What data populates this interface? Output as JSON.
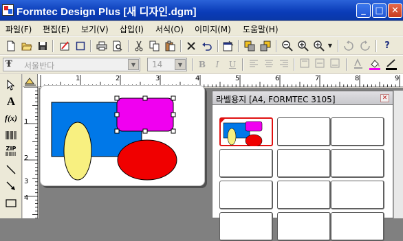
{
  "window": {
    "title": "Formtec Design Plus [새 디자인.dgm]",
    "caption_buttons": [
      "_",
      "□",
      "✕"
    ]
  },
  "menu": [
    {
      "label": "파일(F)"
    },
    {
      "label": "편집(E)"
    },
    {
      "label": "보기(V)"
    },
    {
      "label": "삽입(I)"
    },
    {
      "label": "서식(O)"
    },
    {
      "label": "이미지(M)"
    },
    {
      "label": "도움말(H)"
    }
  ],
  "toolbar1": {
    "icons": [
      "new-icon",
      "open-icon",
      "save-icon",
      "edit-label-icon",
      "select-rect-icon",
      "print-icon",
      "print-preview-icon",
      "cut-icon",
      "copy-icon",
      "paste-icon",
      "delete-icon",
      "undo-icon",
      "properties-icon",
      "group-icon",
      "ungroup-icon",
      "zoom-out-icon",
      "zoom-in-icon",
      "zoom-icon",
      "rotate-left-icon",
      "rotate-right-icon",
      "help-icon"
    ]
  },
  "format_toolbar": {
    "font_name": "서울반다",
    "font_size": "14",
    "bold": "B",
    "italic": "I",
    "underline": "U"
  },
  "tools": [
    "pointer-icon",
    "text-icon",
    "formula-icon",
    "barcode-icon",
    "zip-icon",
    "line-icon",
    "arrow-icon",
    "rectangle-icon"
  ],
  "tool_labels": {
    "text": "A",
    "formula": "f(x)",
    "zip": "ZIP"
  },
  "rulers": {
    "horizontal": [
      "1",
      "2",
      "3",
      "4",
      "5",
      "6",
      "7",
      "8",
      "9"
    ],
    "vertical": [
      "1",
      "2",
      "3",
      "4"
    ]
  },
  "label_window": {
    "title": "라벨용지 [A4, FORMTEC 3105]",
    "close_label": "✕"
  },
  "colors": {
    "title_bar": "#0a3cb8",
    "shape_blue": "#0078e8",
    "shape_magenta": "#f000f0",
    "shape_yellow": "#f8f080",
    "shape_red": "#f00000",
    "active_label_border": "#e01010"
  }
}
